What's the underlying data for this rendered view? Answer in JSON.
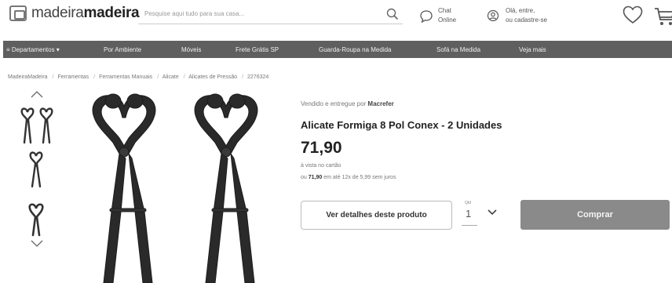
{
  "header": {
    "logo_light": "madeira",
    "logo_bold": "madeira",
    "search_placeholder": "Pesquise aqui tudo para sua casa...",
    "chat_line1": "Chat",
    "chat_line2": "Online",
    "account_line1": "Olá, entre,",
    "account_line2": "ou cadastre-se"
  },
  "nav": {
    "items": [
      "≡ Departamentos ▾",
      "Por Ambiente",
      "Móveis",
      "Frete Grátis SP",
      "Guarda-Roupa na Medida",
      "Sofá na Medida",
      "Veja mais"
    ]
  },
  "breadcrumb": {
    "items": [
      "MadeiraMadeira",
      "Ferramentas",
      "Ferramentas Manuais",
      "Alicate",
      "Alicates de Pressão",
      "2276324"
    ]
  },
  "product": {
    "seller_prefix": "Vendido e entregue por",
    "seller_name": "Macrefer",
    "title": "Alicate Formiga 8 Pol Conex - 2 Unidades",
    "price": "71,90",
    "price_note": "à vista no cartão",
    "installments_prefix": "ou",
    "installments_value": "71,90",
    "installments_suffix": "em até 12x de 5,99 sem juros",
    "details_button": "Ver detalhes deste produto",
    "qty_label": "Qtd",
    "qty_value": "1",
    "buy_button": "Comprar"
  },
  "icons": {
    "search": "search-icon",
    "chat": "chat-icon",
    "account": "user-icon",
    "favorite": "heart-icon",
    "cart": "cart-icon"
  },
  "colors": {
    "nav_background": "#5f5f5f",
    "buy_button": "#8a8a8a",
    "pliers": "#2a2a2a"
  }
}
